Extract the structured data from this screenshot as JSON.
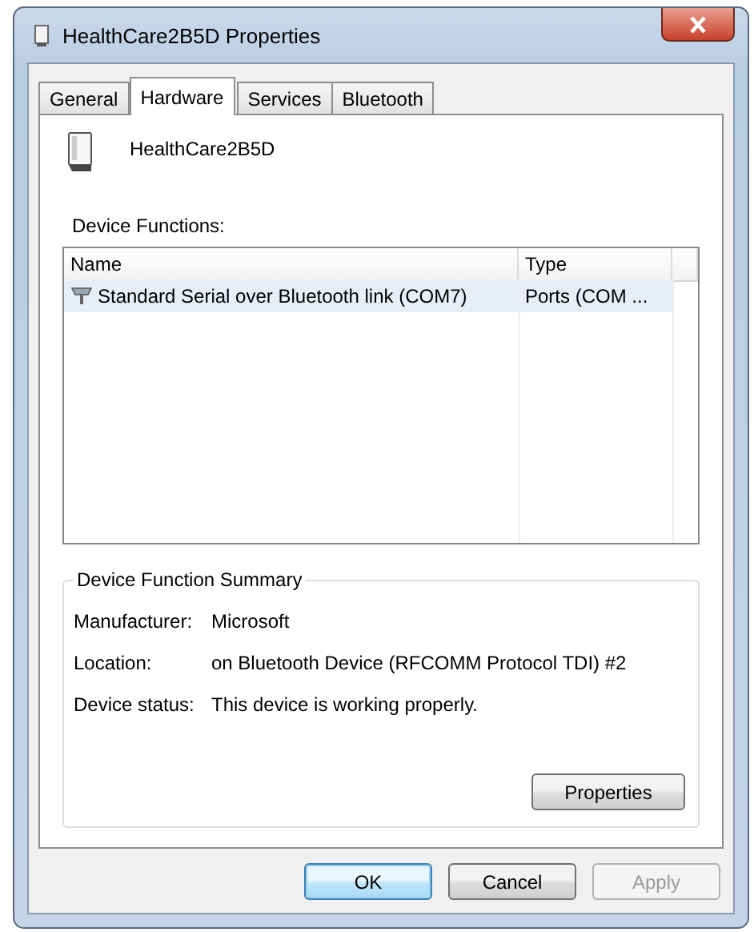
{
  "window": {
    "title": "HealthCare2B5D Properties"
  },
  "tabs": [
    {
      "label": "General",
      "selected": false
    },
    {
      "label": "Hardware",
      "selected": true
    },
    {
      "label": "Services",
      "selected": false
    },
    {
      "label": "Bluetooth",
      "selected": false
    }
  ],
  "device": {
    "name": "HealthCare2B5D"
  },
  "functions": {
    "label": "Device Functions:",
    "columns": [
      "Name",
      "Type"
    ],
    "rows": [
      {
        "name": "Standard Serial over Bluetooth link (COM7)",
        "type": "Ports (COM ...",
        "selected": true
      }
    ]
  },
  "summary": {
    "title": "Device Function Summary",
    "fields": [
      {
        "label": "Manufacturer:",
        "value": "Microsoft"
      },
      {
        "label": "Location:",
        "value": "on Bluetooth Device (RFCOMM Protocol TDI) #2"
      },
      {
        "label": "Device status:",
        "value": "This device is working properly."
      }
    ],
    "button": "Properties"
  },
  "buttons": [
    {
      "label": "OK",
      "kind": "default",
      "disabled": false
    },
    {
      "label": "Cancel",
      "kind": "normal",
      "disabled": false
    },
    {
      "label": "Apply",
      "kind": "normal",
      "disabled": true
    }
  ]
}
